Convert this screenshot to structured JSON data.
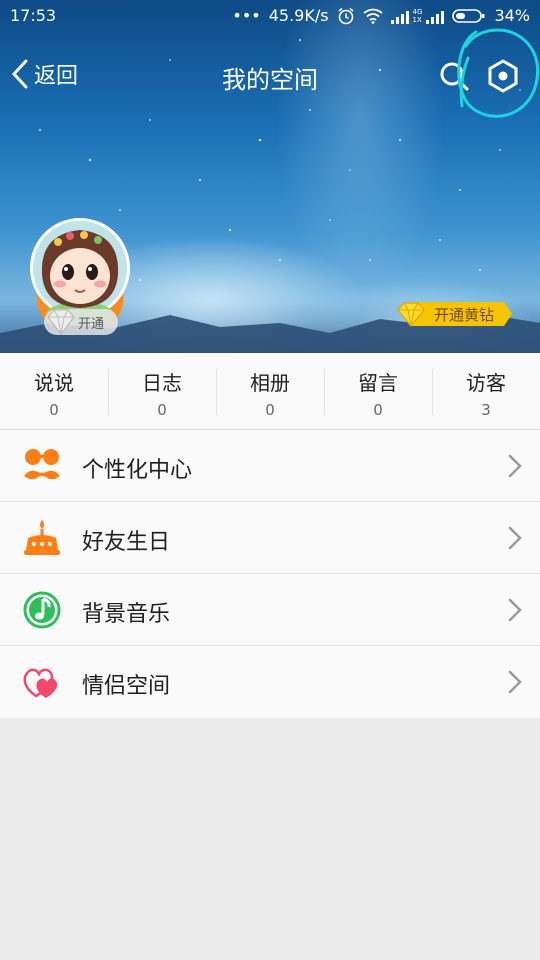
{
  "status_bar": {
    "time": "17:53",
    "network_speed": "45.9K/s",
    "battery": "34%",
    "cell_type_top": "4G",
    "cell_type_bottom": "1X"
  },
  "nav": {
    "back_label": "返回",
    "title": "我的空间",
    "search_icon": "search-icon",
    "settings_icon": "settings-hexagon-icon"
  },
  "profile": {
    "vip_badge_label": "开通",
    "open_yellow_diamond_label": "开通黄钻"
  },
  "stats": [
    {
      "label": "说说",
      "count": "0"
    },
    {
      "label": "日志",
      "count": "0"
    },
    {
      "label": "相册",
      "count": "0"
    },
    {
      "label": "留言",
      "count": "0"
    },
    {
      "label": "访客",
      "count": "3"
    }
  ],
  "menu": [
    {
      "label": "个性化中心",
      "icon": "mustache-glasses-icon"
    },
    {
      "label": "好友生日",
      "icon": "birthday-cake-icon"
    },
    {
      "label": "背景音乐",
      "icon": "music-note-icon"
    },
    {
      "label": "情侣空间",
      "icon": "couple-hearts-icon"
    }
  ],
  "colors": {
    "orange_accent": "#ff7f14",
    "green_accent": "#2dbf5a",
    "pink_accent": "#f2496b",
    "annotation_circle": "#1fd2e0",
    "gold_badge": "#f6c400"
  }
}
